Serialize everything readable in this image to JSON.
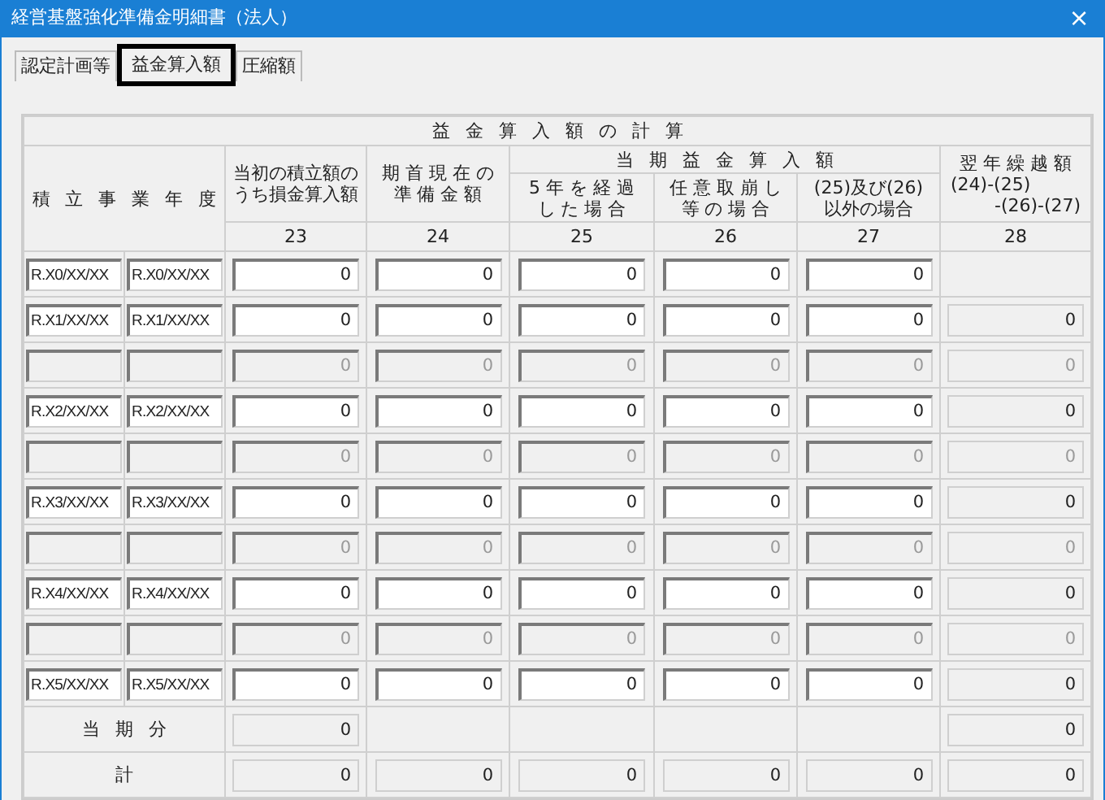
{
  "window": {
    "title": "経営基盤強化準備金明細書（法人）",
    "close": "×"
  },
  "tabs": [
    {
      "label": "認定計画等",
      "selected": false
    },
    {
      "label": "益金算入額",
      "selected": true
    },
    {
      "label": "圧縮額",
      "selected": false
    }
  ],
  "table": {
    "title": "益 金 算 入 額 の 計 算",
    "year_header": "積 立 事 業 年 度",
    "group_header": "当 期 益 金 算 入 額",
    "columns": [
      {
        "number": "23",
        "lines": [
          "当初の積立額の",
          "うち損金算入額"
        ]
      },
      {
        "number": "24",
        "lines": [
          "期 首 現 在 の",
          "準 備 金 額"
        ]
      },
      {
        "number": "25",
        "lines": [
          "5 年 を 経 過",
          "し た 場 合"
        ]
      },
      {
        "number": "26",
        "lines": [
          "任 意 取 崩 し",
          "等 の 場 合"
        ]
      },
      {
        "number": "27",
        "lines": [
          "(25)及び(26)",
          "以外の場合"
        ]
      },
      {
        "number": "28",
        "lines": [
          "翌 年 繰 越 額",
          "(24)-(25)",
          "-(26)-(27)"
        ]
      }
    ],
    "rows": [
      {
        "kind": "dated",
        "from": "R.X0/XX/XX",
        "to": "R.X0/XX/XX",
        "cells": [
          "0",
          "0",
          "0",
          "0",
          "0"
        ],
        "carry": null
      },
      {
        "kind": "dated",
        "from": "R.X1/XX/XX",
        "to": "R.X1/XX/XX",
        "cells": [
          "0",
          "0",
          "0",
          "0",
          "0"
        ],
        "carry": "0"
      },
      {
        "kind": "blank",
        "cells": [
          "0",
          "0",
          "0",
          "0",
          "0"
        ],
        "carry": "0"
      },
      {
        "kind": "dated",
        "from": "R.X2/XX/XX",
        "to": "R.X2/XX/XX",
        "cells": [
          "0",
          "0",
          "0",
          "0",
          "0"
        ],
        "carry": "0"
      },
      {
        "kind": "blank",
        "cells": [
          "0",
          "0",
          "0",
          "0",
          "0"
        ],
        "carry": "0"
      },
      {
        "kind": "dated",
        "from": "R.X3/XX/XX",
        "to": "R.X3/XX/XX",
        "cells": [
          "0",
          "0",
          "0",
          "0",
          "0"
        ],
        "carry": "0"
      },
      {
        "kind": "blank",
        "cells": [
          "0",
          "0",
          "0",
          "0",
          "0"
        ],
        "carry": "0"
      },
      {
        "kind": "dated",
        "from": "R.X4/XX/XX",
        "to": "R.X4/XX/XX",
        "cells": [
          "0",
          "0",
          "0",
          "0",
          "0"
        ],
        "carry": "0"
      },
      {
        "kind": "blank",
        "cells": [
          "0",
          "0",
          "0",
          "0",
          "0"
        ],
        "carry": "0"
      },
      {
        "kind": "dated",
        "from": "R.X5/XX/XX",
        "to": "R.X5/XX/XX",
        "cells": [
          "0",
          "0",
          "0",
          "0",
          "0"
        ],
        "carry": "0"
      }
    ],
    "totals": [
      {
        "label": "当 期 分",
        "cells": [
          "0",
          null,
          null,
          null,
          null,
          "0"
        ]
      },
      {
        "label": "計",
        "cells": [
          "0",
          "0",
          "0",
          "0",
          "0",
          "0"
        ]
      }
    ]
  }
}
